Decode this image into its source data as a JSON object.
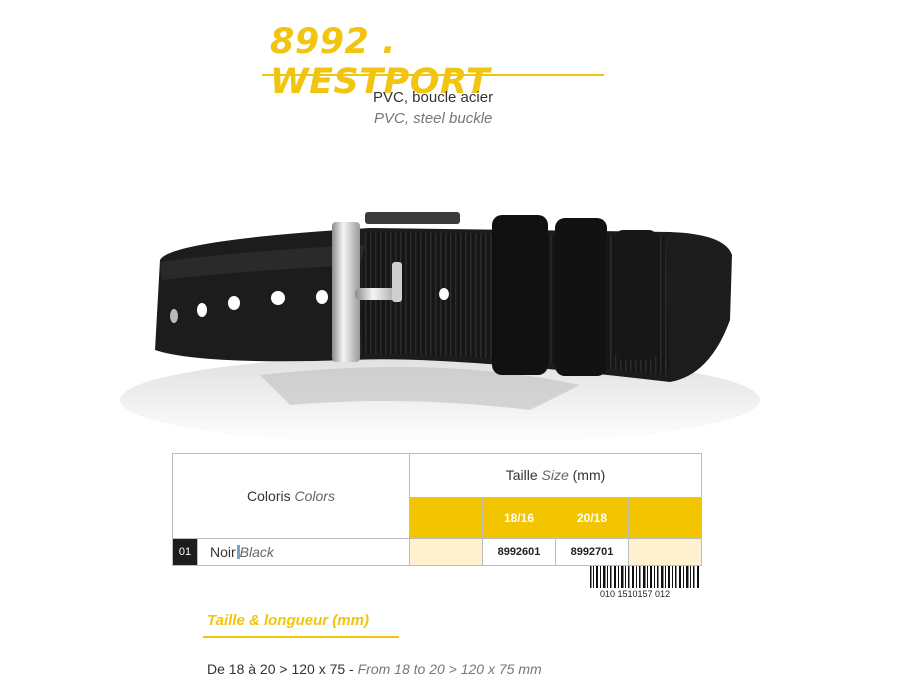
{
  "product": {
    "title": "8992 . WESTPORT",
    "material_fr": "PVC, boucle acier",
    "material_en": "PVC, steel buckle"
  },
  "table": {
    "colors_fr": "Coloris",
    "colors_en": "Colors",
    "size_fr": "Taille",
    "size_en": "Size",
    "size_unit": "(mm)",
    "sizes": [
      "18/16",
      "20/18"
    ],
    "rows": [
      {
        "num": "01",
        "name_fr": "Noir",
        "name_en": "Black",
        "refs": [
          "8992601",
          "8992701"
        ]
      }
    ]
  },
  "barcode": {
    "number": "010 1510157 012"
  },
  "dimensions": {
    "title": "Taille & longueur (mm)",
    "text_fr": "De 18 à 20 > 120 x 75 - ",
    "text_en": "From 18 to 20 > 120 x 75 mm"
  },
  "colors": {
    "accent": "#f1c40f",
    "cream": "#fdf1cf",
    "strap": "#1a1a1a"
  }
}
